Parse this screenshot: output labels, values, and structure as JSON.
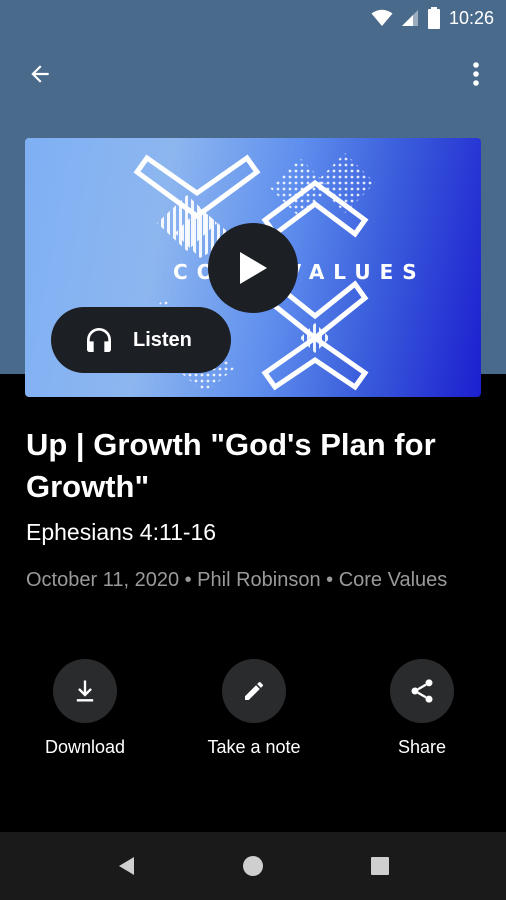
{
  "status_bar": {
    "time": "10:26",
    "wifi_icon": "wifi-icon",
    "signal_icon": "cell-signal-icon",
    "battery_icon": "battery-icon"
  },
  "app_bar": {
    "back_icon": "arrow-back-icon",
    "more_icon": "more-vert-icon"
  },
  "artwork": {
    "text": "CORE VALUES",
    "listen_label": "Listen"
  },
  "sermon": {
    "title": "Up | Growth  \"God's Plan for Growth\"",
    "scripture": "Ephesians 4:11-16",
    "meta": "October 11, 2020 • Phil Robinson • Core Values"
  },
  "actions": [
    {
      "label": "Download",
      "icon": "download-icon"
    },
    {
      "label": "Take a note",
      "icon": "pencil-icon"
    },
    {
      "label": "Share",
      "icon": "share-icon"
    }
  ],
  "colors": {
    "header_bg": "#4a6a8b",
    "page_bg": "#000000",
    "button_bg": "#1c1f24",
    "meta_text": "#9a9a9a"
  }
}
